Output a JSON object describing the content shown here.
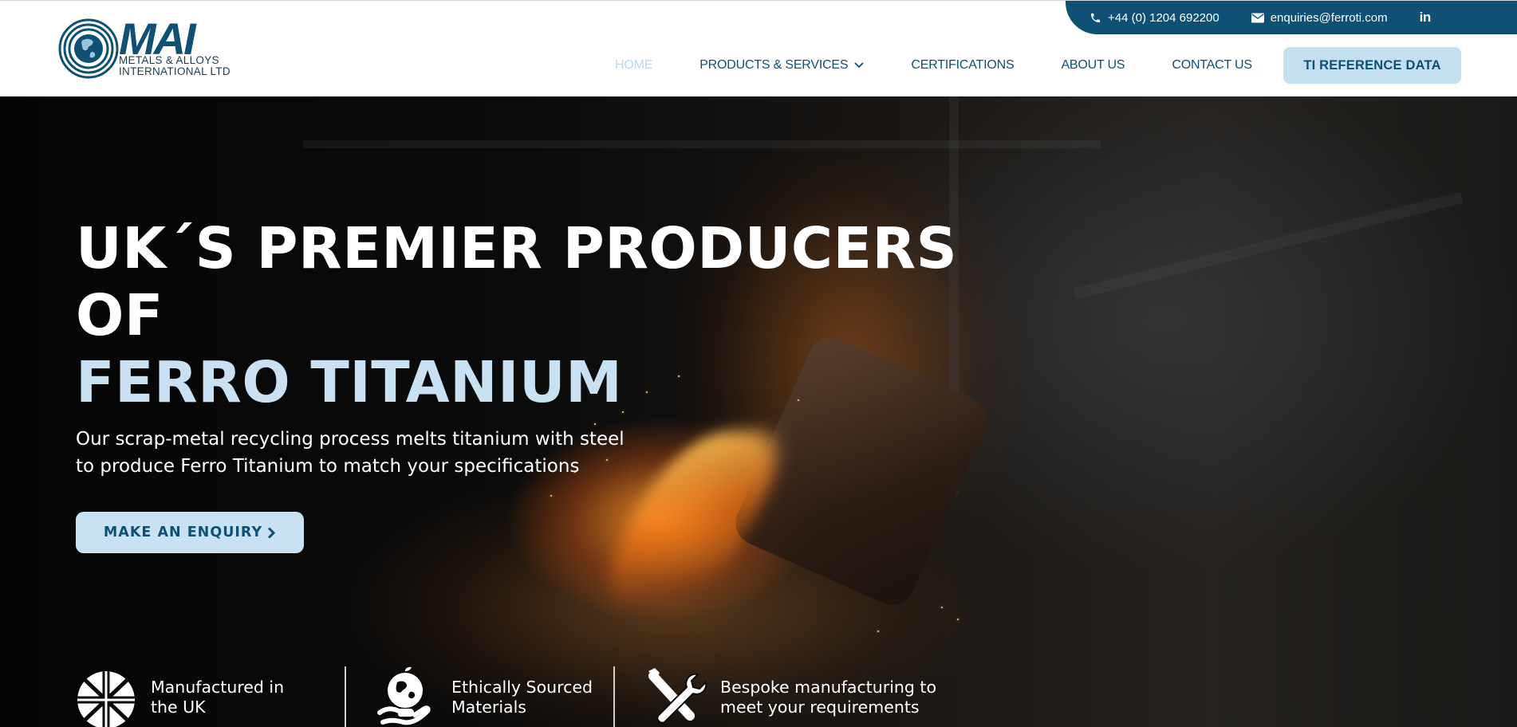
{
  "brand": {
    "logo_text": "MAI",
    "logo_sub_line1": "METALS & ALLOYS",
    "logo_sub_line2": "INTERNATIONAL LTD"
  },
  "topbar": {
    "phone": "+44 (0) 1204 692200",
    "email": "enquiries@ferroti.com",
    "linkedin": "in"
  },
  "nav": {
    "items": [
      {
        "label": "HOME",
        "active": true
      },
      {
        "label": "PRODUCTS & SERVICES",
        "has_dropdown": true
      },
      {
        "label": "CERTIFICATIONS"
      },
      {
        "label": "ABOUT US"
      },
      {
        "label": "CONTACT US"
      }
    ],
    "cta": "TI REFERENCE DATA"
  },
  "hero": {
    "title_line1": "UK´S PREMIER PRODUCERS",
    "title_line2": "OF",
    "title_line3": "FERRO TITANIUM",
    "subtitle_line1": "Our scrap-metal recycling process melts titanium with steel",
    "subtitle_line2": "to produce Ferro Titanium to match your specifications",
    "button": "MAKE AN ENQUIRY"
  },
  "features": [
    {
      "icon": "union-jack-icon",
      "line1": "Manufactured in",
      "line2": "the UK"
    },
    {
      "icon": "globe-in-hand-icon",
      "line1": "Ethically Sourced",
      "line2": "Materials"
    },
    {
      "icon": "tools-icon",
      "line1": "Bespoke manufacturing to",
      "line2": "meet your requirements"
    }
  ],
  "colors": {
    "primary": "#0f5075",
    "accent_light": "#c8e2f4",
    "nav_active": "#bcd8ea"
  }
}
